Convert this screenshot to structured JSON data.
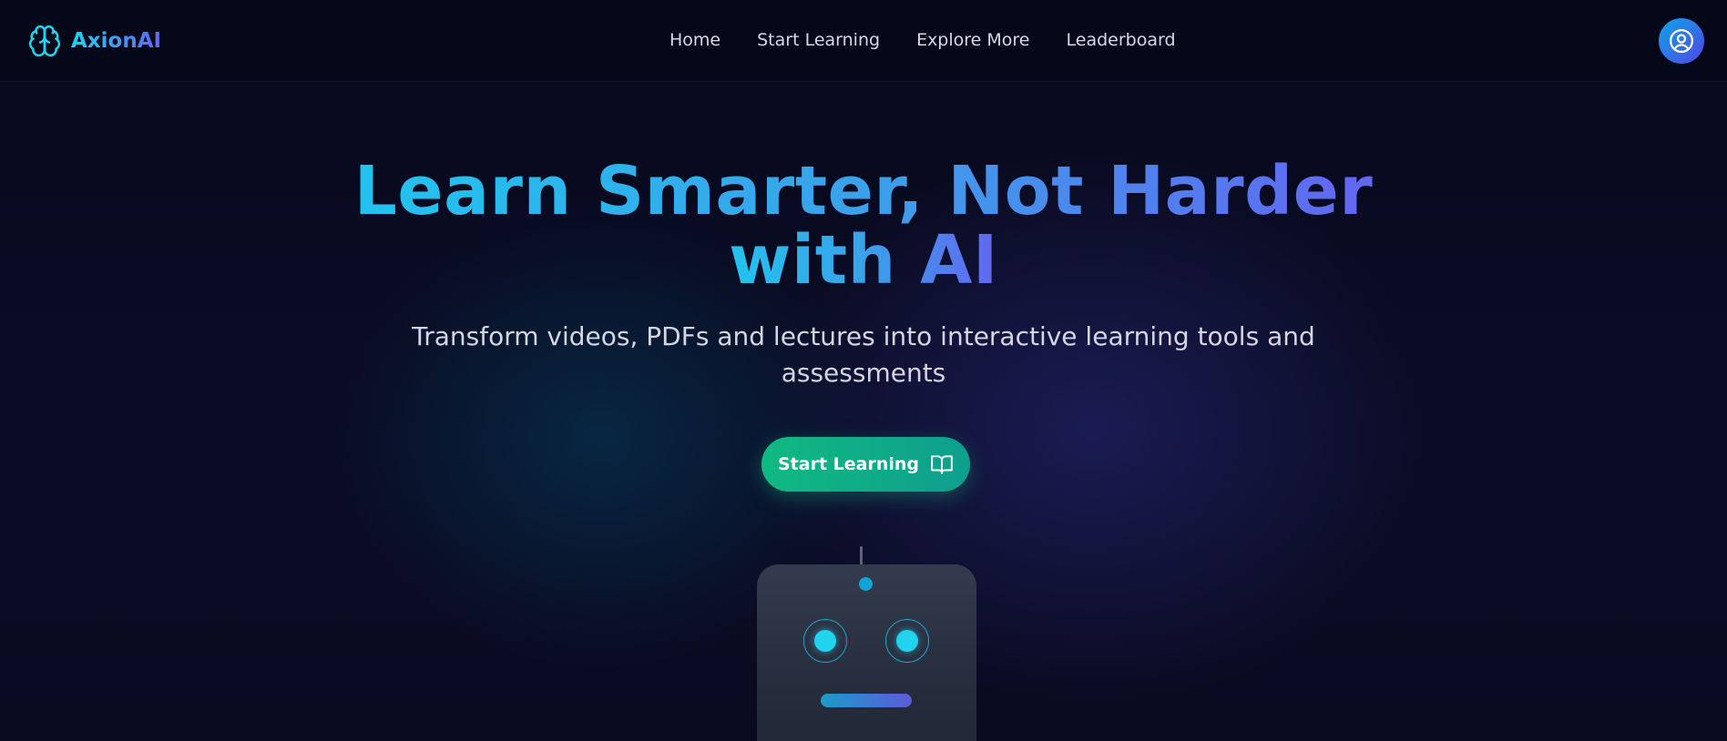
{
  "brand": {
    "name": "AxionAI",
    "logo_icon": "brain-icon"
  },
  "nav": {
    "links": [
      "Home",
      "Start Learning",
      "Explore More",
      "Leaderboard"
    ],
    "profile_icon": "user-circle-icon"
  },
  "hero": {
    "title_line1": "Learn Smarter, Not Harder",
    "title_line2": "with AI",
    "subtitle_line1": "Transform videos, PDFs and lectures into interactive learning tools and",
    "subtitle_line2": "assessments",
    "cta_label": "Start Learning",
    "cta_icon": "open-book-icon"
  },
  "colors": {
    "background": "#070a1d",
    "accent_cyan": "#22d3ee",
    "accent_indigo": "#6366f1",
    "cta_green": "#10b981"
  }
}
